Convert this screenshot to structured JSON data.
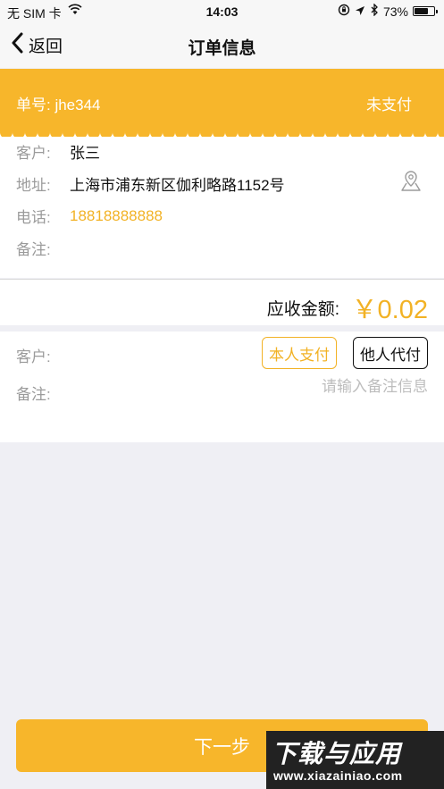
{
  "status_bar": {
    "carrier": "无 SIM 卡",
    "time": "14:03",
    "battery": "73%",
    "battery_level": 0.73
  },
  "nav": {
    "back_label": "返回",
    "title": "订单信息"
  },
  "order": {
    "number_label": "单号: jhe344",
    "status": "未支付"
  },
  "customer": {
    "name_label": "客户:",
    "name": "张三",
    "address_label": "地址:",
    "address": "上海市浦东新区伽利略路1152号",
    "phone_label": "电话:",
    "phone": "18818888888",
    "remark_label": "备注:"
  },
  "amount": {
    "label": "应收金额:",
    "value": "￥0.02"
  },
  "payment": {
    "customer_label": "客户:",
    "self_pay_label": "本人支付",
    "other_pay_label": "他人代付",
    "remark_label": "备注:",
    "remark_placeholder": "请输入备注信息"
  },
  "next_button": "下一步",
  "watermark": {
    "title": "下载与应用",
    "url": "www.xiazainiao.com"
  },
  "colors": {
    "accent": "#f7b62b",
    "accent_text": "#f2b225",
    "background": "#efeff4"
  }
}
